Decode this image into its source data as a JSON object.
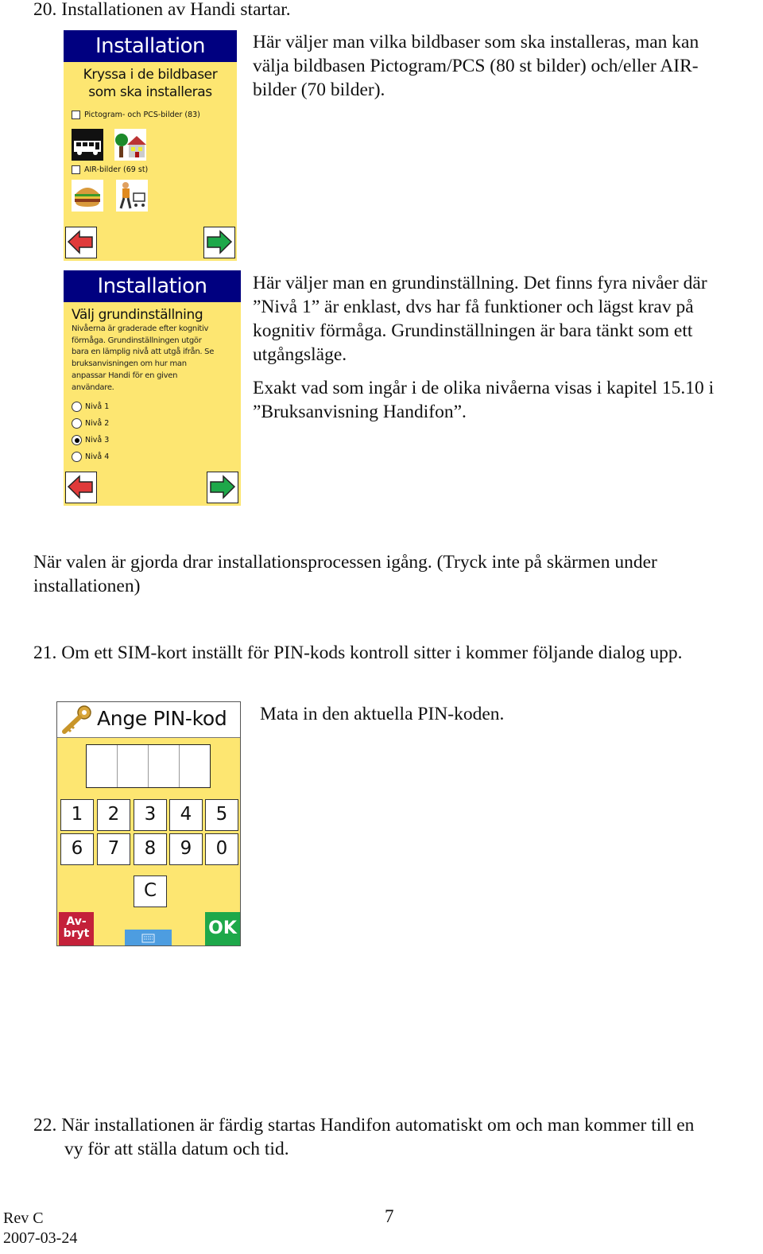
{
  "sections": {
    "s20": {
      "heading": "20. Installationen av Handi startar.",
      "desc1_lines": [
        "Här väljer man vilka bildbaser som ska installeras, man kan",
        "välja bildbasen Pictogram/PCS (80 st bilder) och/eller AIR-",
        "bilder (70 bilder)."
      ],
      "desc2_lines": [
        "Här väljer man en grundinställning. Det finns fyra nivåer där",
        "”Nivå 1” är enklast, dvs har få funktioner och lägst krav på",
        "kognitiv förmåga. Grundinställningen är bara tänkt som ett",
        "utgångsläge."
      ],
      "desc3_lines": [
        "Exakt vad som ingår i de olika nivåerna visas i kapitel 15.10 i",
        "”Bruksanvisning Handifon”."
      ],
      "after_lines": [
        "När valen är gjorda drar installationsprocessen igång. (Tryck inte på skärmen under",
        "installationen)"
      ]
    },
    "s21": {
      "heading": "21. Om ett SIM-kort inställt för PIN-kods kontroll sitter i kommer följande dialog upp.",
      "desc": "Mata in den aktuella PIN-koden."
    },
    "s22": {
      "heading_lines": [
        "22. När installationen är färdig startas Handifon automatiskt om och man kommer till en",
        "vy för att ställa datum och tid."
      ]
    }
  },
  "screen1": {
    "title": "Installation",
    "subtitle_lines": [
      "Kryssa i de bildbaser",
      "som ska installeras"
    ],
    "options": [
      {
        "label": "Pictogram- och PCS-bilder (83)",
        "checked": false,
        "thumbs": [
          "bus-icon",
          "house-icon"
        ]
      },
      {
        "label": "AIR-bilder (69 st)",
        "checked": false,
        "thumbs": [
          "hamburger-icon",
          "shopping-cart-icon"
        ]
      }
    ],
    "back_icon": "arrow-left-icon",
    "next_icon": "arrow-right-icon"
  },
  "screen2": {
    "title": "Installation",
    "subtitle": "Välj grundinställning",
    "body_lines": [
      "Nivåerna är graderade efter kognitiv",
      "förmåga. Grundinställningen utgör",
      "bara en lämplig nivå att utgå ifrån. Se",
      "bruksanvisningen om hur man",
      "anpassar Handi för en given",
      "användare."
    ],
    "levels": [
      {
        "label": "Nivå 1",
        "selected": false
      },
      {
        "label": "Nivå 2",
        "selected": false
      },
      {
        "label": "Nivå 3",
        "selected": true
      },
      {
        "label": "Nivå 4",
        "selected": false
      }
    ]
  },
  "pin_dialog": {
    "title": "Ange PIN-kod",
    "icon": "key-icon",
    "digits_row1": [
      "1",
      "2",
      "3",
      "4",
      "5"
    ],
    "digits_row2": [
      "6",
      "7",
      "8",
      "9",
      "0"
    ],
    "clear_label": "C",
    "abort_line1": "Av-",
    "abort_line2": "bryt",
    "ok_label": "OK",
    "keyboard_icon": "keyboard-icon",
    "colors": {
      "abort": "#c4213a",
      "ok": "#1ea84a",
      "keyboard": "#4d9de0",
      "background": "#fde671"
    }
  },
  "footer": {
    "rev": "Rev C",
    "date": "2007-03-24",
    "page": "7"
  },
  "colors": {
    "screen_bg": "#fde671",
    "title_bar": "#000080"
  }
}
